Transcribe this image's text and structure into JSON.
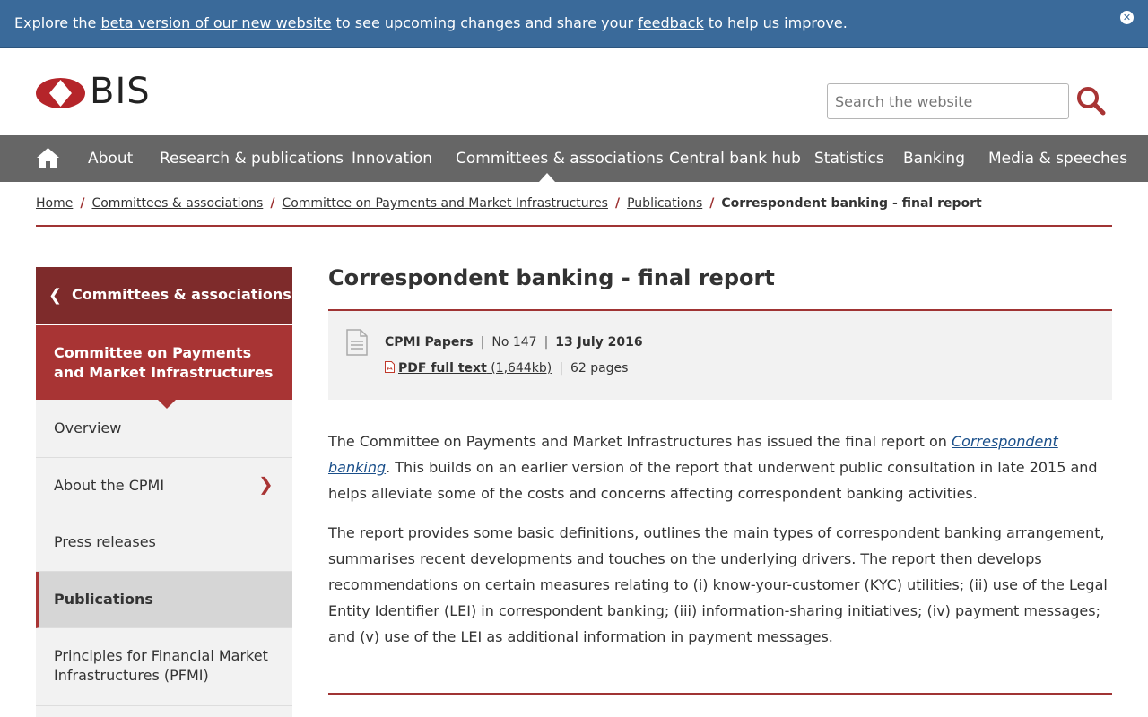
{
  "banner": {
    "prefix": "Explore the ",
    "beta_link": "beta version of our new website",
    "middle": " to see upcoming changes and share your ",
    "feedback_link": "feedback",
    "suffix": " to help us improve.",
    "close_icon": "close-icon"
  },
  "header": {
    "logo_text": "BIS",
    "search_placeholder": "Search the website",
    "search_icon": "search-icon"
  },
  "nav": {
    "items": [
      "About",
      "Research & publications",
      "Innovation",
      "Committees & associations",
      "Central bank hub",
      "Statistics",
      "Banking",
      "Media & speeches"
    ],
    "active": "Committees & associations"
  },
  "breadcrumb": {
    "items": [
      "Home",
      "Committees & associations",
      "Committee on Payments and Market Infrastructures",
      "Publications"
    ],
    "current": "Correspondent banking - final report"
  },
  "sidebar": {
    "back_label": "Committees & associations",
    "section_label": "Committee on Payments and Market Infrastructures",
    "items": [
      {
        "label": "Overview"
      },
      {
        "label": "About the CPMI"
      },
      {
        "label": "Press releases"
      },
      {
        "label": "Publications"
      },
      {
        "label": "Principles for Financial Market Infrastructures (PFMI)"
      }
    ]
  },
  "content": {
    "title": "Correspondent banking - final report",
    "meta": {
      "series": "CPMI Papers",
      "number": "No 147",
      "date": "13 July 2016",
      "pdf_label": "PDF full text",
      "pdf_size": "(1,644kb)",
      "pages": "62 pages"
    },
    "para1_pre": "The Committee on Payments and Market Infrastructures has issued the final report on ",
    "para1_link": "Correspondent banking",
    "para1_post": ". This builds on an earlier version of the report that underwent public consultation in late 2015 and helps alleviate some of the costs and concerns affecting correspondent banking activities.",
    "para2": "The report provides some basic definitions, outlines the main types of correspondent banking arrangement, summarises recent developments and touches on the underlying drivers. The report then develops recommendations on certain measures relating to (i) know-your-customer (KYC) utilities; (ii) use of the Legal Entity Identifier (LEI) in correspondent banking; (iii) information-sharing initiatives; (iv) payment messages; and (v) use of the LEI as additional information in payment messages."
  },
  "colors": {
    "banner_bg": "#3a6a9a",
    "nav_bg": "#666666",
    "accent_red": "#a83434",
    "dark_red": "#7e2b2b"
  }
}
